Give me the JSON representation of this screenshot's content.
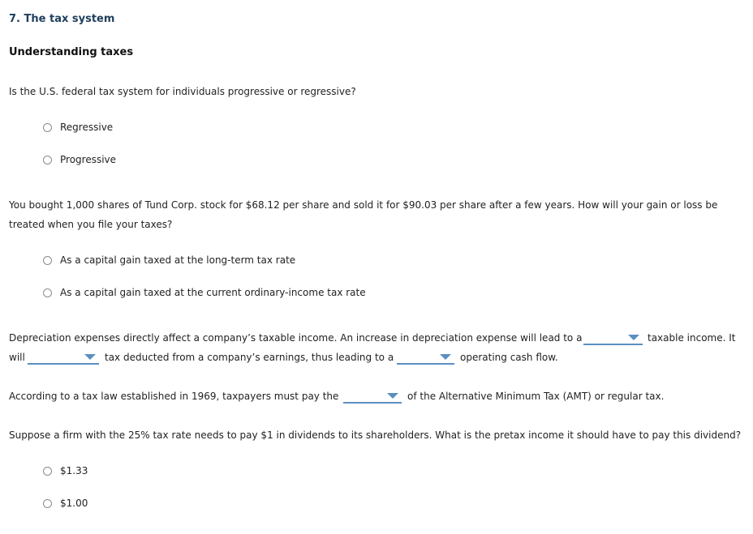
{
  "header": {
    "title": "7. The tax system",
    "subtitle": "Understanding taxes"
  },
  "q1": {
    "text": "Is the U.S. federal tax system for individuals progressive or regressive?",
    "options": [
      "Regressive",
      "Progressive"
    ]
  },
  "q2": {
    "line1": "You bought 1,000 shares of Tund Corp. stock for $68.12 per share and sold it for $90.03 per share after a few years. How will your gain or loss be",
    "line2": "treated when you file your taxes?",
    "options": [
      "As a capital gain taxed at the long-term tax rate",
      "As a capital gain taxed at the current ordinary-income tax rate"
    ]
  },
  "q3": {
    "part1": "Depreciation expenses directly affect a company’s taxable income. An increase in depreciation expense will lead to a",
    "part2": "taxable income. It",
    "part3": "will",
    "part4": "tax deducted from a company’s earnings, thus leading to a",
    "part5": "operating cash flow.",
    "dropdowns": [
      "",
      "",
      ""
    ]
  },
  "q4": {
    "part1": "According to a tax law established in 1969, taxpayers must pay the",
    "part2": "of the Alternative Minimum Tax (AMT) or regular tax.",
    "dropdown": ""
  },
  "q5": {
    "text": "Suppose a firm with the 25% tax rate needs to pay $1 in dividends to its shareholders. What is the pretax income it should have to pay this dividend?",
    "options": [
      "$1.33",
      "$1.00"
    ]
  }
}
